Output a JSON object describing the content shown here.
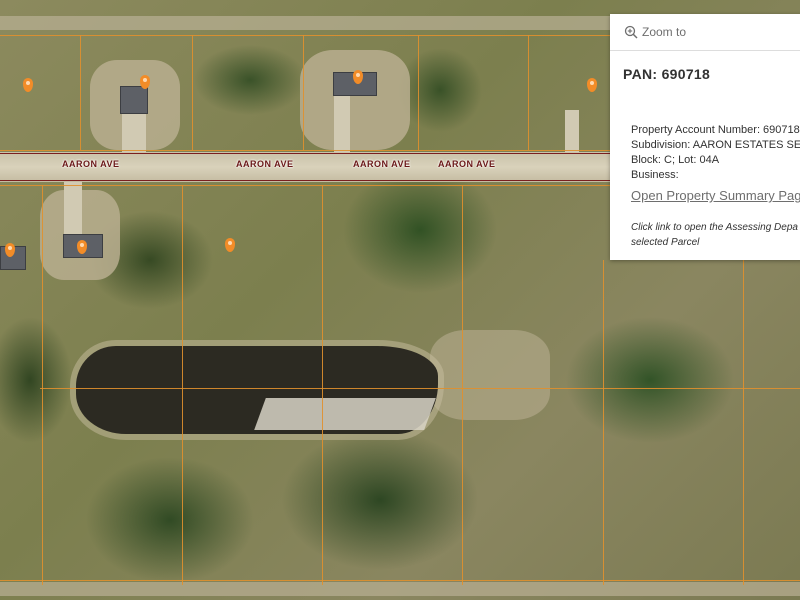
{
  "map": {
    "road_labels": [
      "AARON AVE",
      "AARON AVE",
      "AARON AVE",
      "AARON AVE"
    ],
    "parcel_line_color": "#e0902e",
    "road_line_color": "#7a1f1f",
    "pin_color": "#f28c28",
    "pins": [
      "parcel-pin",
      "parcel-pin",
      "parcel-pin",
      "parcel-pin",
      "parcel-pin",
      "parcel-pin",
      "parcel-pin"
    ]
  },
  "popup": {
    "zoom_icon": "magnifier-plus-icon",
    "zoom_label": "Zoom to",
    "title": "PAN: 690718",
    "attributes": [
      "Property Account Number: 690718",
      "Subdivision: AARON ESTATES SEC",
      "Block: C;  Lot:  04A",
      "Business:"
    ],
    "link": "Open Property Summary Pag",
    "note": "Click link to open the Assessing Depa selected Parcel"
  }
}
